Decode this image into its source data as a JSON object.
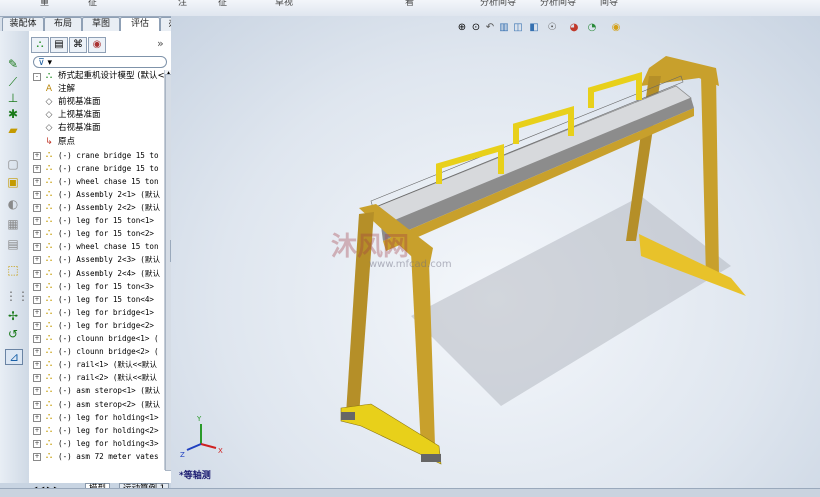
{
  "topbar": {
    "cut_labels": [
      "重",
      "征",
      "注",
      "征",
      "草视",
      "看",
      "分析间导",
      "分析间导",
      "间导"
    ]
  },
  "tabs": [
    "装配体",
    "布局",
    "草图",
    "评估",
    "办公室产品"
  ],
  "active_tab": "评估",
  "panel": {
    "collapse_glyph": "»",
    "filter_symbol": "▾"
  },
  "tree": [
    {
      "icon": "assembly-icon",
      "label": "桥式起重机设计模型  (默认<",
      "cjk": true,
      "exp": "-"
    },
    {
      "icon": "annotation-icon",
      "label": "注解",
      "cjk": true,
      "exp": ""
    },
    {
      "icon": "plane-icon",
      "label": "前视基准面",
      "cjk": true,
      "exp": ""
    },
    {
      "icon": "plane-icon",
      "label": "上视基准面",
      "cjk": true,
      "exp": ""
    },
    {
      "icon": "plane-icon",
      "label": "右视基准面",
      "cjk": true,
      "exp": ""
    },
    {
      "icon": "origin-icon",
      "label": "原点",
      "cjk": true,
      "exp": ""
    },
    {
      "icon": "subassembly-icon",
      "label": "(-) crane bridge 15 to",
      "cjk": false,
      "exp": "+"
    },
    {
      "icon": "subassembly-icon",
      "label": "(-) crane bridge 15 to",
      "cjk": false,
      "exp": "+"
    },
    {
      "icon": "subassembly-icon",
      "label": "(-) wheel chase 15 ton",
      "cjk": false,
      "exp": "+"
    },
    {
      "icon": "subassembly-icon",
      "label": "(-) Assembly 2<1> (默认",
      "cjk": false,
      "exp": "+"
    },
    {
      "icon": "subassembly-icon",
      "label": "(-) Assembly 2<2> (默认",
      "cjk": false,
      "exp": "+"
    },
    {
      "icon": "subassembly-icon",
      "label": "(-) leg for 15  ton<1>",
      "cjk": false,
      "exp": "+"
    },
    {
      "icon": "subassembly-icon",
      "label": "(-) leg for 15  ton<2>",
      "cjk": false,
      "exp": "+"
    },
    {
      "icon": "subassembly-icon",
      "label": "(-) wheel chase 15 ton",
      "cjk": false,
      "exp": "+"
    },
    {
      "icon": "subassembly-icon",
      "label": "(-) Assembly 2<3> (默认",
      "cjk": false,
      "exp": "+"
    },
    {
      "icon": "subassembly-icon",
      "label": "(-) Assembly 2<4> (默认",
      "cjk": false,
      "exp": "+"
    },
    {
      "icon": "subassembly-icon",
      "label": "(-) leg for 15  ton<3>",
      "cjk": false,
      "exp": "+"
    },
    {
      "icon": "subassembly-icon",
      "label": "(-) leg for 15  ton<4>",
      "cjk": false,
      "exp": "+"
    },
    {
      "icon": "subassembly-icon",
      "label": "(-) leg for bridge<1>",
      "cjk": false,
      "exp": "+"
    },
    {
      "icon": "subassembly-icon",
      "label": "(-) leg for bridge<2>",
      "cjk": false,
      "exp": "+"
    },
    {
      "icon": "subassembly-icon",
      "label": "(-) clounn bridge<1> (",
      "cjk": false,
      "exp": "+"
    },
    {
      "icon": "subassembly-icon",
      "label": "(-) clounn bridge<2> (",
      "cjk": false,
      "exp": "+"
    },
    {
      "icon": "subassembly-icon",
      "label": "(-) rail<1> (默认<<默认",
      "cjk": false,
      "exp": "+"
    },
    {
      "icon": "subassembly-icon",
      "label": "(-) rail<2> (默认<<默认",
      "cjk": false,
      "exp": "+"
    },
    {
      "icon": "subassembly-icon",
      "label": "(-) asm sterop<1> (默认",
      "cjk": false,
      "exp": "+"
    },
    {
      "icon": "subassembly-icon",
      "label": "(-) asm sterop<2> (默认",
      "cjk": false,
      "exp": "+"
    },
    {
      "icon": "subassembly-icon",
      "label": "(-) leg for holding<1>",
      "cjk": false,
      "exp": "+"
    },
    {
      "icon": "subassembly-icon",
      "label": "(-) leg for holding<2>",
      "cjk": false,
      "exp": "+"
    },
    {
      "icon": "subassembly-icon",
      "label": "(-) leg for holding<3>",
      "cjk": false,
      "exp": "+"
    },
    {
      "icon": "subassembly-icon",
      "label": "(-) asm 72 meter vates",
      "cjk": false,
      "exp": "+"
    }
  ],
  "bottom_tabs": [
    "模型",
    "运动算例 1"
  ],
  "active_bottom_tab": "模型",
  "viewport": {
    "view_label": "*等轴测",
    "watermark": "沐风网",
    "watermark_url": "www.mfcad.com",
    "axis_labels": {
      "x": "X",
      "y": "Y",
      "z": "Z"
    }
  },
  "colors": {
    "frame_yellow": "#e8c22a",
    "frame_brown": "#b0902c",
    "beam_gray": "#8c8c8c",
    "accent_blue": "#1a1a70"
  }
}
